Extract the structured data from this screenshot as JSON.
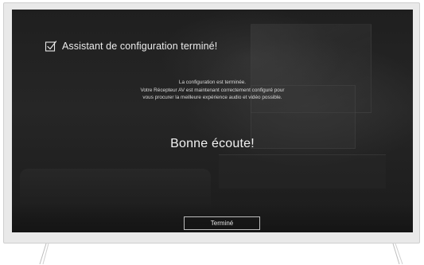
{
  "dialog": {
    "title": "Assistant de configuration terminé!",
    "message_lines": [
      "La configuration est terminée.",
      "Votre Récepteur AV est maintenant correctement configuré pour",
      "vous procurer la meilleure expérience audio et vidéo possible."
    ],
    "farewell": "Bonne écoute!",
    "done_label": "Terminé"
  },
  "icons": {
    "header": "checkbox-checked-icon"
  },
  "colors": {
    "screen_background": "#222222",
    "text": "#ececec",
    "button_border": "#bdbdbd",
    "frame": "#e9e9e9"
  }
}
